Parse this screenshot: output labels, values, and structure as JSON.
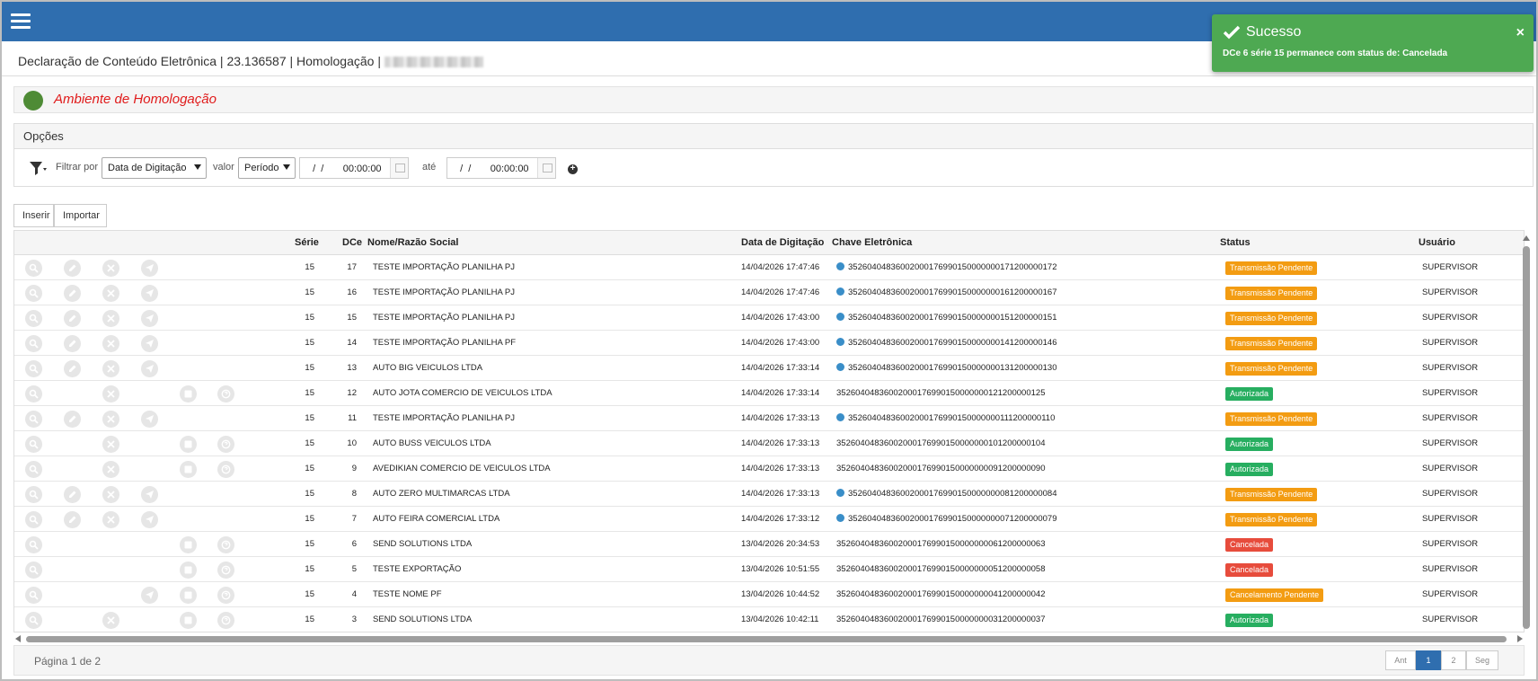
{
  "breadcrumb": "Declaração de Conteúdo Eletrônica | 23.136587 | Homologação |",
  "environment_label": "Ambiente de Homologação",
  "options_title": "Opções",
  "filter": {
    "filter_by_label": "Filtrar por",
    "field_value": "Data de Digitação",
    "value_label": "valor",
    "mode_value": "Período",
    "start_date": "  /  /       00:00:00",
    "until_label": "até",
    "end_date": "  /  /       00:00:00"
  },
  "actions": {
    "insert": "Inserir",
    "import": "Importar"
  },
  "columns": {
    "serie": "Série",
    "dce": "DCe",
    "name": "Nome/Razão Social",
    "date": "Data de Digitação",
    "key": "Chave Eletrônica",
    "status": "Status",
    "user": "Usuário"
  },
  "rows": [
    {
      "serie": "15",
      "dce": "17",
      "name": "TESTE IMPORTAÇÃO PLANILHA PJ",
      "date": "14/04/2026 17:47:46",
      "key": "35260404836002000176990150000000171200000172",
      "key_dot": true,
      "status": "Transmissão Pendente",
      "status_type": "pending",
      "user": "SUPERVISOR",
      "icons": [
        "search",
        "edit",
        "cancel",
        "send"
      ]
    },
    {
      "serie": "15",
      "dce": "16",
      "name": "TESTE IMPORTAÇÃO PLANILHA PJ",
      "date": "14/04/2026 17:47:46",
      "key": "35260404836002000176990150000000161200000167",
      "key_dot": true,
      "status": "Transmissão Pendente",
      "status_type": "pending",
      "user": "SUPERVISOR",
      "icons": [
        "search",
        "edit",
        "cancel",
        "send"
      ]
    },
    {
      "serie": "15",
      "dce": "15",
      "name": "TESTE IMPORTAÇÃO PLANILHA PJ",
      "date": "14/04/2026 17:43:00",
      "key": "35260404836002000176990150000000151200000151",
      "key_dot": true,
      "status": "Transmissão Pendente",
      "status_type": "pending",
      "user": "SUPERVISOR",
      "icons": [
        "search",
        "edit",
        "cancel",
        "send"
      ]
    },
    {
      "serie": "15",
      "dce": "14",
      "name": "TESTE IMPORTAÇÃO PLANILHA PF",
      "date": "14/04/2026 17:43:00",
      "key": "35260404836002000176990150000000141200000146",
      "key_dot": true,
      "status": "Transmissão Pendente",
      "status_type": "pending",
      "user": "SUPERVISOR",
      "icons": [
        "search",
        "edit",
        "cancel",
        "send"
      ]
    },
    {
      "serie": "15",
      "dce": "13",
      "name": "AUTO BIG VEICULOS LTDA",
      "date": "14/04/2026 17:33:14",
      "key": "35260404836002000176990150000000131200000130",
      "key_dot": true,
      "status": "Transmissão Pendente",
      "status_type": "pending",
      "user": "SUPERVISOR",
      "icons": [
        "search",
        "edit",
        "cancel",
        "send"
      ]
    },
    {
      "serie": "15",
      "dce": "12",
      "name": "AUTO JOTA COMERCIO DE VEICULOS LTDA",
      "date": "14/04/2026 17:33:14",
      "key": "35260404836002000176990150000000121200000125",
      "key_dot": false,
      "status": "Autorizada",
      "status_type": "authorized",
      "user": "SUPERVISOR",
      "icons": [
        "search",
        "cancel",
        "print",
        "help"
      ]
    },
    {
      "serie": "15",
      "dce": "11",
      "name": "TESTE IMPORTAÇÃO PLANILHA PJ",
      "date": "14/04/2026 17:33:13",
      "key": "35260404836002000176990150000000111200000110",
      "key_dot": true,
      "status": "Transmissão Pendente",
      "status_type": "pending",
      "user": "SUPERVISOR",
      "icons": [
        "search",
        "edit",
        "cancel",
        "send"
      ]
    },
    {
      "serie": "15",
      "dce": "10",
      "name": "AUTO BUSS VEICULOS LTDA",
      "date": "14/04/2026 17:33:13",
      "key": "35260404836002000176990150000000101200000104",
      "key_dot": false,
      "status": "Autorizada",
      "status_type": "authorized",
      "user": "SUPERVISOR",
      "icons": [
        "search",
        "cancel",
        "print",
        "help"
      ]
    },
    {
      "serie": "15",
      "dce": "9",
      "name": "AVEDIKIAN COMERCIO DE VEICULOS LTDA",
      "date": "14/04/2026 17:33:13",
      "key": "35260404836002000176990150000000091200000090",
      "key_dot": false,
      "status": "Autorizada",
      "status_type": "authorized",
      "user": "SUPERVISOR",
      "icons": [
        "search",
        "cancel",
        "print",
        "help"
      ]
    },
    {
      "serie": "15",
      "dce": "8",
      "name": "AUTO ZERO MULTIMARCAS LTDA",
      "date": "14/04/2026 17:33:13",
      "key": "35260404836002000176990150000000081200000084",
      "key_dot": true,
      "status": "Transmissão Pendente",
      "status_type": "pending",
      "user": "SUPERVISOR",
      "icons": [
        "search",
        "edit",
        "cancel",
        "send"
      ]
    },
    {
      "serie": "15",
      "dce": "7",
      "name": "AUTO FEIRA COMERCIAL LTDA",
      "date": "14/04/2026 17:33:12",
      "key": "35260404836002000176990150000000071200000079",
      "key_dot": true,
      "status": "Transmissão Pendente",
      "status_type": "pending",
      "user": "SUPERVISOR",
      "icons": [
        "search",
        "edit",
        "cancel",
        "send"
      ]
    },
    {
      "serie": "15",
      "dce": "6",
      "name": "SEND SOLUTIONS LTDA",
      "date": "13/04/2026 20:34:53",
      "key": "35260404836002000176990150000000061200000063",
      "key_dot": false,
      "status": "Cancelada",
      "status_type": "canceled",
      "user": "SUPERVISOR",
      "icons": [
        "search",
        "print",
        "help"
      ]
    },
    {
      "serie": "15",
      "dce": "5",
      "name": "TESTE EXPORTAÇÃO",
      "date": "13/04/2026 10:51:55",
      "key": "35260404836002000176990150000000051200000058",
      "key_dot": false,
      "status": "Cancelada",
      "status_type": "canceled",
      "user": "SUPERVISOR",
      "icons": [
        "search",
        "print",
        "help"
      ]
    },
    {
      "serie": "15",
      "dce": "4",
      "name": "TESTE NOME PF",
      "date": "13/04/2026 10:44:52",
      "key": "35260404836002000176990150000000041200000042",
      "key_dot": false,
      "status": "Cancelamento Pendente",
      "status_type": "pending",
      "user": "SUPERVISOR",
      "icons": [
        "search",
        "send",
        "print",
        "help"
      ]
    },
    {
      "serie": "15",
      "dce": "3",
      "name": "SEND SOLUTIONS LTDA",
      "date": "13/04/2026 10:42:11",
      "key": "35260404836002000176990150000000031200000037",
      "key_dot": false,
      "status": "Autorizada",
      "status_type": "authorized",
      "user": "SUPERVISOR",
      "icons": [
        "search",
        "cancel",
        "print",
        "help"
      ]
    }
  ],
  "status_colors": {
    "pending": "#f39c12",
    "authorized": "#27ae60",
    "canceled": "#e74c3c"
  },
  "pagination": {
    "info": "Página 1 de 2",
    "prev": "Ant",
    "pages": [
      "1",
      "2"
    ],
    "current": "1",
    "next": "Seg"
  },
  "toast": {
    "title": "Sucesso",
    "message": "DCe 6 série 15 permanece com status de: Cancelada",
    "close_symbol": "×"
  },
  "colors": {
    "header": "#2f6eaf",
    "toast": "#4ea952",
    "env_dot": "#4e8b35",
    "env_text": "#e01b1b",
    "key_dot": "#3a8ec8"
  }
}
